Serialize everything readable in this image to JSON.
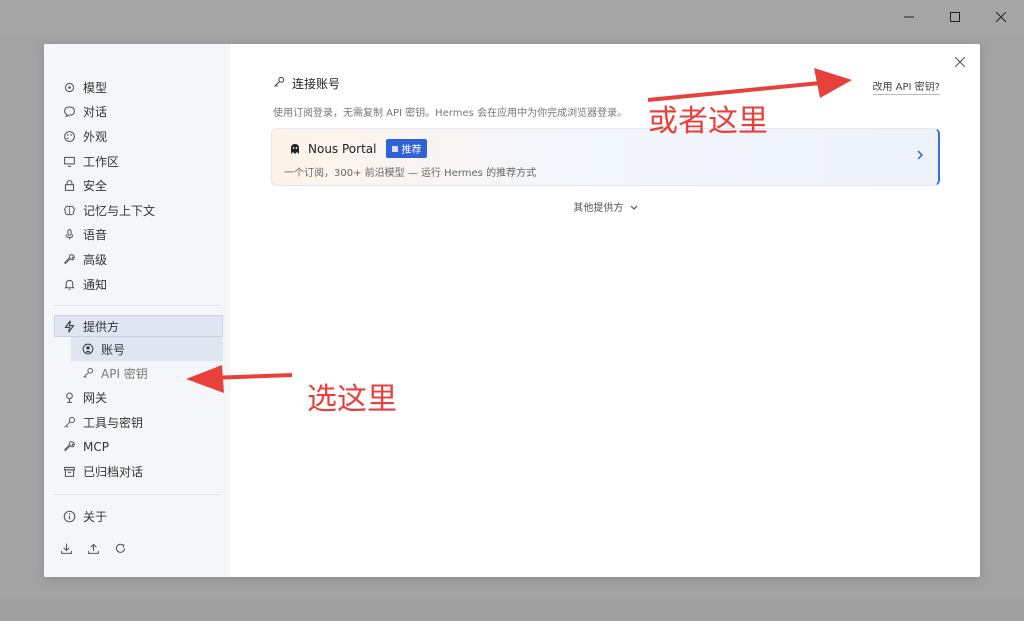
{
  "sidebar": {
    "items": [
      {
        "label": "模型",
        "icon": "cube-icon"
      },
      {
        "label": "对话",
        "icon": "chat-bubble-icon"
      },
      {
        "label": "外观",
        "icon": "palette-icon"
      },
      {
        "label": "工作区",
        "icon": "monitor-icon"
      },
      {
        "label": "安全",
        "icon": "lock-icon"
      },
      {
        "label": "记忆与上下文",
        "icon": "brain-icon"
      },
      {
        "label": "语音",
        "icon": "microphone-icon"
      },
      {
        "label": "高级",
        "icon": "wrench-icon"
      },
      {
        "label": "通知",
        "icon": "bell-icon"
      }
    ],
    "provider": {
      "label": "提供方",
      "icon": "lightning-icon"
    },
    "provider_subitems": [
      {
        "label": "账号",
        "icon": "user-circle-icon"
      },
      {
        "label": "API 密钥",
        "icon": "key-icon"
      }
    ],
    "items2": [
      {
        "label": "网关",
        "icon": "gateway-icon"
      },
      {
        "label": "工具与密钥",
        "icon": "key-icon"
      },
      {
        "label": "MCP",
        "icon": "plug-icon"
      },
      {
        "label": "已归档对话",
        "icon": "archive-icon"
      }
    ],
    "about": {
      "label": "关于",
      "icon": "info-icon"
    },
    "bottom_icons": [
      "download-icon",
      "upload-icon",
      "refresh-icon"
    ]
  },
  "main": {
    "title": "连接账号",
    "alt_link": "改用 API 密钥?",
    "description": "使用订阅登录，无需复制 API 密钥。Hermes 会在应用中为你完成浏览器登录。",
    "provider": {
      "name": "Nous Portal",
      "badge": "推荐",
      "description": "一个订阅，300+ 前沿模型 — 运行 Hermes 的推荐方式"
    },
    "others_label": "其他提供方"
  },
  "annotations": {
    "top": "或者这里",
    "left": "选这里",
    "color": "#e8413c"
  },
  "colors": {
    "accent": "#2f62d9",
    "sidebar_bg": "#f4f6f9"
  }
}
